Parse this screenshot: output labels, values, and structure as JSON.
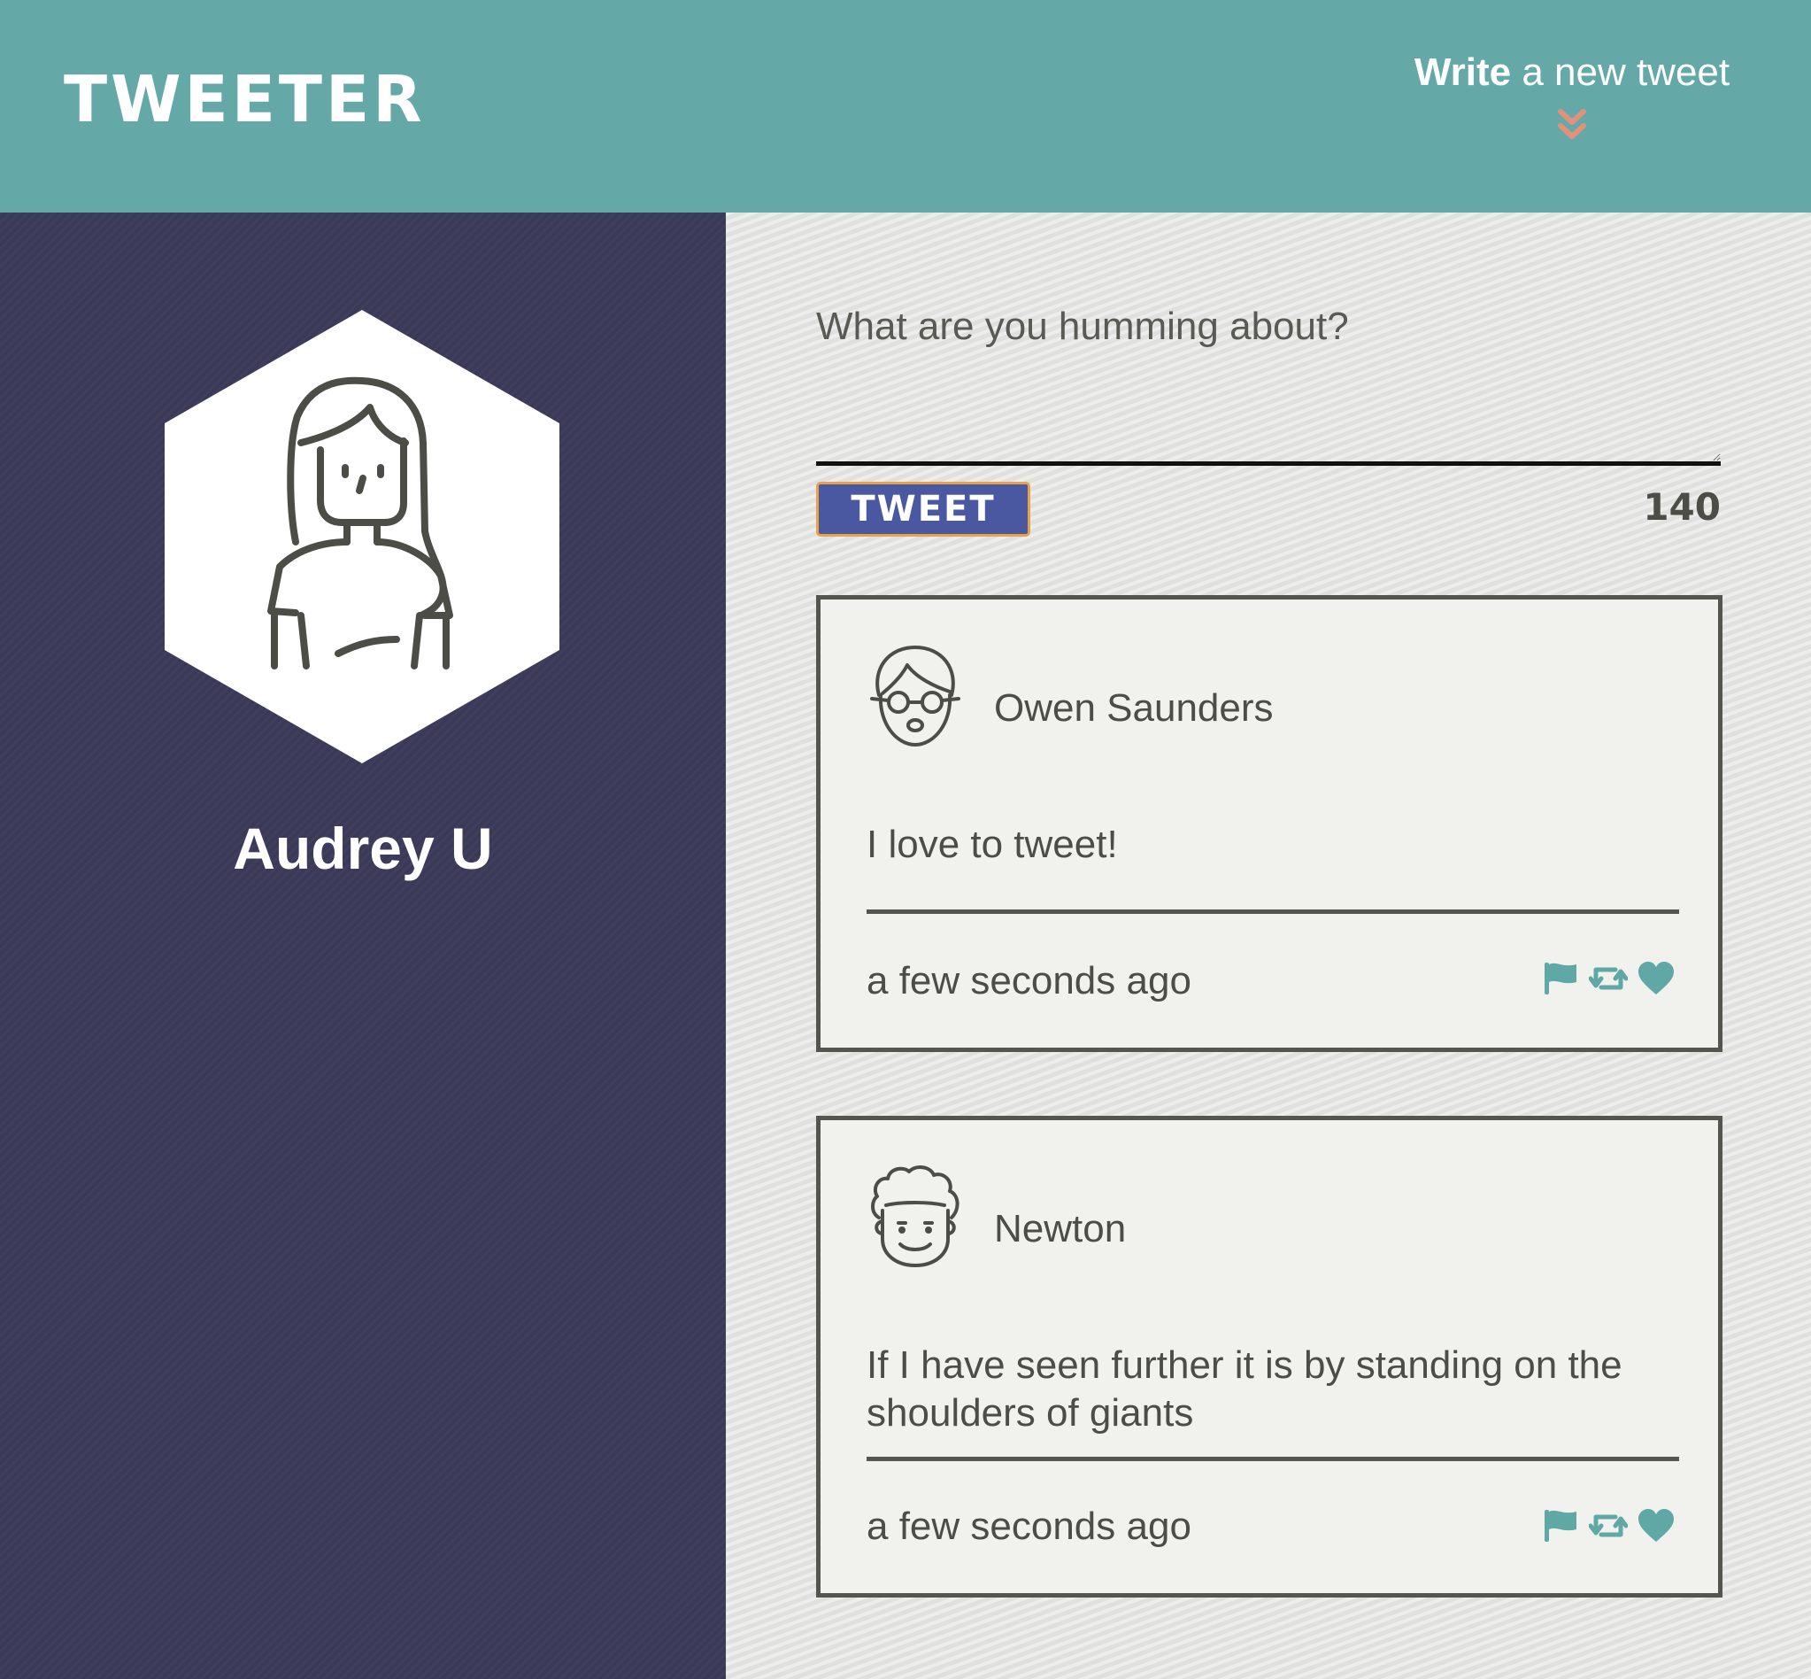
{
  "header": {
    "brand": "TWEETER",
    "compose_bold": "Write",
    "compose_rest": " a new tweet"
  },
  "profile": {
    "name": "Audrey U"
  },
  "composer": {
    "placeholder": "What are you humming about?",
    "submit_label": "TWEET",
    "counter": "140"
  },
  "tweets": [
    {
      "author": "Owen Saunders",
      "text": "I love to tweet!",
      "time": "a few seconds ago",
      "avatar_icon": "glasses-person-icon"
    },
    {
      "author": "Newton",
      "text": "If I have seen further it is by standing on the shoulders of giants",
      "time": "a few seconds ago",
      "avatar_icon": "curly-hair-person-icon"
    }
  ],
  "icons": {
    "actions": [
      "flag-icon",
      "retweet-icon",
      "heart-icon"
    ]
  },
  "colors": {
    "header_bg": "#64a8a7",
    "sidebar_bg": "#3b3a59",
    "accent": "#5fa8a5",
    "chevron": "#e4917c",
    "button_bg": "#4a58a2",
    "button_border": "#e8a24b"
  }
}
